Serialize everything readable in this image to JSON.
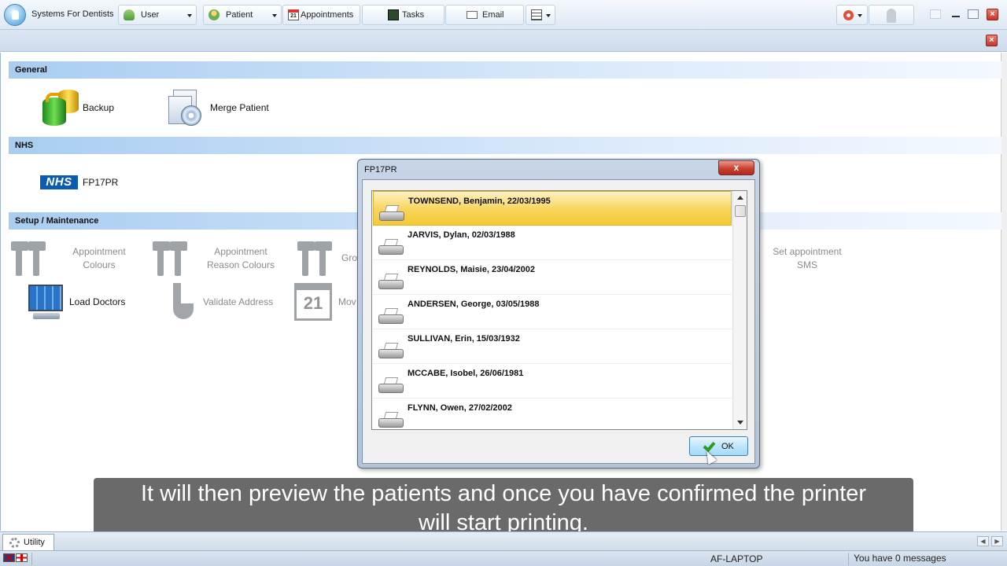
{
  "app": {
    "title": "Systems For Dentists"
  },
  "toolbar": {
    "user": "User",
    "patient": "Patient",
    "appointments": "Appointments",
    "appointments_icon_text": "21",
    "tasks": "Tasks",
    "email": "Email"
  },
  "sections": {
    "general": "General",
    "nhs": "NHS",
    "setup": "Setup / Maintenance"
  },
  "general_items": {
    "backup": "Backup",
    "merge_patient": "Merge Patient"
  },
  "nhs_items": {
    "logo": "NHS",
    "fp17pr": "FP17PR"
  },
  "setup_items": {
    "appointment_colours": "Appointment Colours",
    "appointment_reason_colours": "Appointment Reason Colours",
    "group_partial": "Gro",
    "set_appointment_sms": "Set appointment SMS",
    "load_doctors": "Load Doctors",
    "validate_address": "Validate Address",
    "move_partial": "Mov",
    "calendar_icon_text": "21"
  },
  "dialog": {
    "title": "FP17PR",
    "close": "x",
    "ok": "OK",
    "patients": [
      "TOWNSEND, Benjamin, 22/03/1995",
      "JARVIS, Dylan, 02/03/1988",
      "REYNOLDS, Maisie, 23/04/2002",
      "ANDERSEN, George, 03/05/1988",
      "SULLIVAN, Erin, 15/03/1932",
      "MCCABE, Isobel, 26/06/1981",
      "FLYNN, Owen, 27/02/2002"
    ]
  },
  "caption": {
    "line1": "It will then preview the patients and once you have confirmed the printer",
    "line2": "will start printing."
  },
  "tabs": {
    "utility": "Utility"
  },
  "status": {
    "machine": "AF-LAPTOP",
    "messages": "You have 0 messages"
  },
  "colors": {
    "selected_row": "#f8d45a",
    "section_band": "#a9cdf0",
    "close_red": "#c8402f",
    "nhs_blue": "#0b5bb0"
  }
}
